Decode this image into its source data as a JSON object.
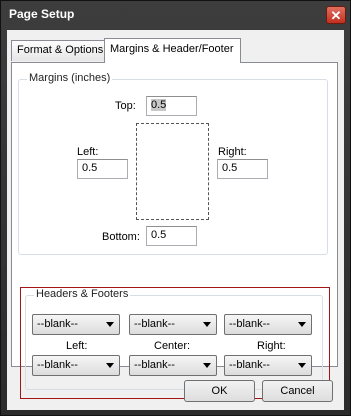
{
  "window": {
    "title": "Page Setup",
    "close_glyph": "✕"
  },
  "tabs": [
    {
      "label": "Format & Options"
    },
    {
      "label": "Margins & Header/Footer"
    }
  ],
  "margins": {
    "legend": "Margins (inches)",
    "top_label": "Top:",
    "top_value": "0.5",
    "left_label": "Left:",
    "left_value": "0.5",
    "right_label": "Right:",
    "right_value": "0.5",
    "bottom_label": "Bottom:",
    "bottom_value": "0.5"
  },
  "headers_footers": {
    "legend": "Headers & Footers",
    "header_left": "--blank--",
    "header_center": "--blank--",
    "header_right": "--blank--",
    "left_label": "Left:",
    "center_label": "Center:",
    "right_label": "Right:",
    "footer_left": "--blank--",
    "footer_center": "--blank--",
    "footer_right": "--blank--"
  },
  "buttons": {
    "ok": "OK",
    "cancel": "Cancel"
  },
  "colors": {
    "highlight_border": "#a31515",
    "titlebar": "#3d3d3d",
    "close_button": "#c0301f"
  }
}
